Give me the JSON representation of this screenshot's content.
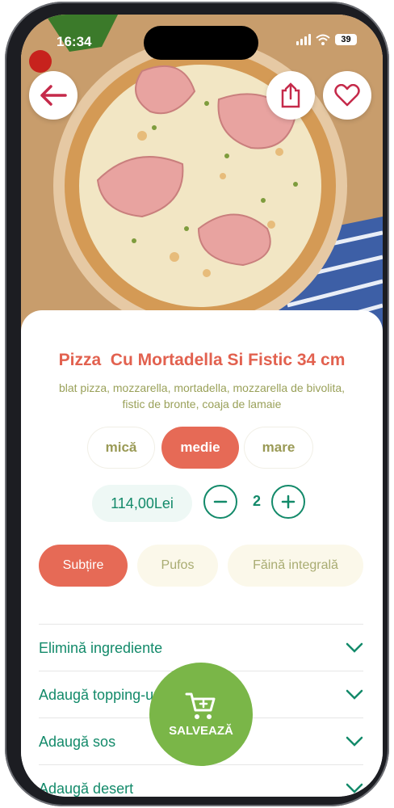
{
  "status": {
    "time": "16:34",
    "battery": "39"
  },
  "product": {
    "title": "Pizza  Cu Mortadella Si Fistic 34 cm",
    "description": "blat pizza, mozzarella, mortadella, mozzarella de bivolita, fistic de bronte, coaja de lamaie"
  },
  "sizes": [
    {
      "label": "mică",
      "selected": false
    },
    {
      "label": "medie",
      "selected": true
    },
    {
      "label": "mare",
      "selected": false
    }
  ],
  "price": "114,00Lei",
  "quantity": "2",
  "crusts": [
    {
      "label": "Subțire",
      "selected": true
    },
    {
      "label": "Pufos",
      "selected": false
    },
    {
      "label": "Făină integrală",
      "selected": false
    }
  ],
  "options": [
    {
      "label": "Elimină ingrediente"
    },
    {
      "label": "Adaugă topping-uri"
    },
    {
      "label": "Adaugă sos"
    },
    {
      "label": "Adaugă desert"
    }
  ],
  "save_label": "SALVEAZĂ",
  "colors": {
    "accent": "#e66a56",
    "primary_green": "#138a6a",
    "save_green": "#7ab648",
    "muted_olive": "#9aa15a"
  },
  "icons": {
    "back": "arrow-left-icon",
    "share": "share-icon",
    "favorite": "heart-icon",
    "cart": "cart-icon",
    "expand": "chevron-down-icon"
  }
}
